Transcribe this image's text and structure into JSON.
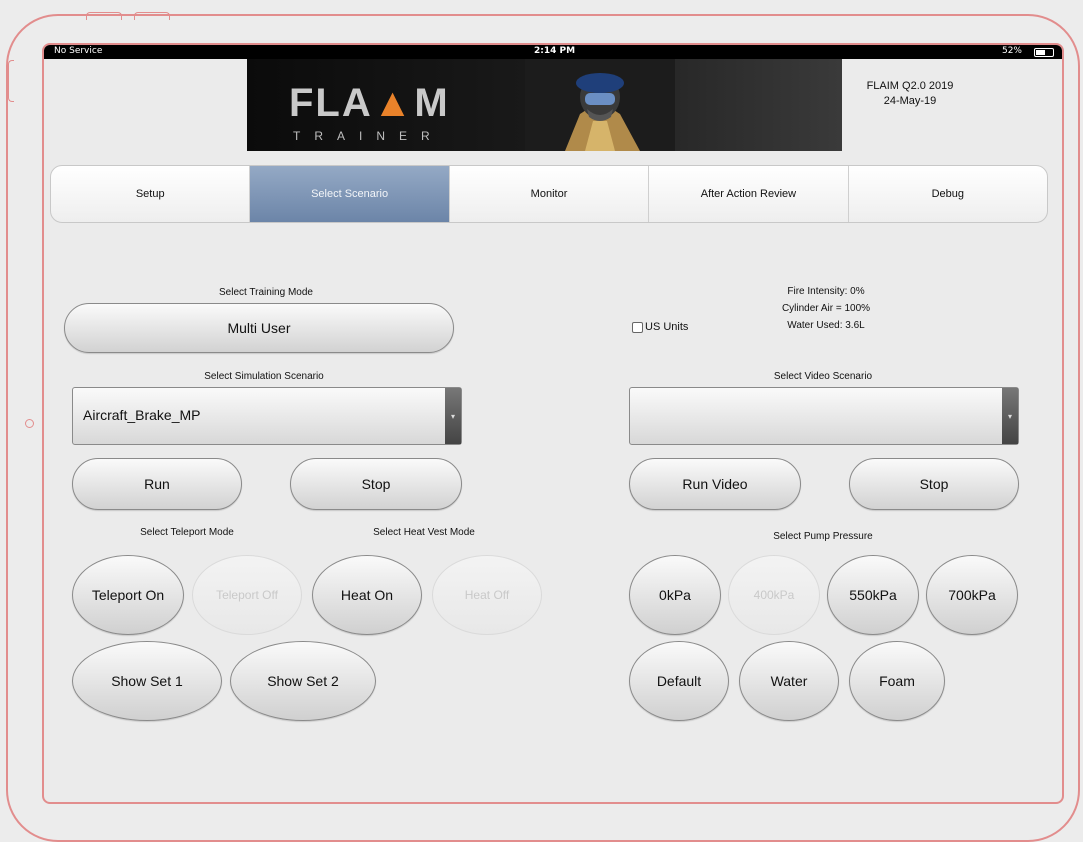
{
  "status_bar": {
    "service": "No Service",
    "time": "2:14 PM",
    "battery": "52%"
  },
  "banner": {
    "logo_main": "FLA",
    "logo_mark": "▲",
    "logo_end": "M",
    "logo_sub": "TRAINER"
  },
  "version": {
    "line1": "FLAIM Q2.0 2019",
    "line2": "24-May-19"
  },
  "tabs": [
    "Setup",
    "Select Scenario",
    "Monitor",
    "After Action Review",
    "Debug"
  ],
  "active_tab": "Select Scenario",
  "training_mode": {
    "label": "Select Training Mode",
    "value": "Multi User"
  },
  "units": {
    "label": "US Units",
    "checked": false
  },
  "stats": {
    "fire": "Fire Intensity: 0%",
    "cylinder": "Cylinder Air = 100%",
    "water": "Water Used: 3.6L"
  },
  "sim_scenario": {
    "label": "Select Simulation Scenario",
    "value": "Aircraft_Brake_MP",
    "run": "Run",
    "stop": "Stop"
  },
  "video_scenario": {
    "label": "Select Video Scenario",
    "value": "",
    "run": "Run Video",
    "stop": "Stop"
  },
  "teleport": {
    "label": "Select Teleport Mode",
    "on": "Teleport On",
    "off": "Teleport Off"
  },
  "heat": {
    "label": "Select Heat Vest Mode",
    "on": "Heat On",
    "off": "Heat Off"
  },
  "show_sets": {
    "set1": "Show Set 1",
    "set2": "Show Set 2"
  },
  "pump": {
    "label": "Select Pump Pressure",
    "p0": "0kPa",
    "p400": "400kPa",
    "p550": "550kPa",
    "p700": "700kPa"
  },
  "agents": {
    "default": "Default",
    "water": "Water",
    "foam": "Foam"
  },
  "colors": {
    "outline": "#e28d8d",
    "active_tab": "#7d93b3",
    "flame": "#e9822a"
  }
}
